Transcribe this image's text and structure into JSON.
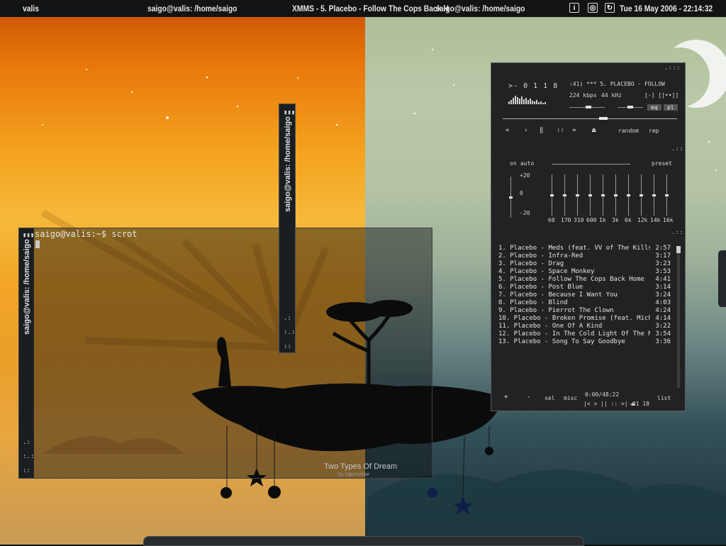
{
  "topbar": {
    "menu_label": "valis",
    "window_title_1": "saigo@valis: /home/saigo",
    "window_title_2": "XMMS - 5. Placebo - Follow The Cops Back H",
    "window_title_3": "saigo@valis: /home/saigo",
    "datetime": "Tue 16 May 2006 - 22:14:32",
    "tray_icons": [
      "info-icon",
      "camera-icon",
      "refresh-icon"
    ]
  },
  "wallpaper": {
    "caption": "Two Types Of Dream",
    "credit": "by UgurValdar"
  },
  "terminal": {
    "side_title": "saigo@valis: /home/saigo",
    "prompt_line": "saigo@valis:~$ scrot"
  },
  "small_window": {
    "side_title": "saigo@valis: /home/saigo"
  },
  "xmms": {
    "time": "- 0 1 1 8",
    "ticker": ":41)  ***  5. PLACEBO - FOLLOW",
    "kbps": "224",
    "kbps_unit": "kbps",
    "khz": "44",
    "khz_unit": "kHz",
    "mono_stereo": "[-]  [[••]]",
    "eq_button": "eq",
    "pl_button": "pl",
    "random_label": "random",
    "repeat_label": "rep",
    "transport": [
      "prev-icon",
      "play-icon",
      "pause-icon",
      "stop-icon",
      "next-icon",
      "eject-icon"
    ],
    "seek_position": 0.58,
    "volume_level": 0.55,
    "balance_level": 0.5,
    "equalizer": {
      "on_label": "on",
      "auto_label": "auto",
      "preset_label": "preset",
      "scale_top": "+20",
      "scale_mid": "0",
      "scale_bottom": "-20",
      "preamp": 0.5,
      "bands": [
        {
          "label": "60",
          "level": 0.5
        },
        {
          "label": "170",
          "level": 0.5
        },
        {
          "label": "310",
          "level": 0.5
        },
        {
          "label": "600",
          "level": 0.5
        },
        {
          "label": "1k",
          "level": 0.5
        },
        {
          "label": "3k",
          "level": 0.5
        },
        {
          "label": "6k",
          "level": 0.5
        },
        {
          "label": "12k",
          "level": 0.5
        },
        {
          "label": "14k",
          "level": 0.5
        },
        {
          "label": "16k",
          "level": 0.5
        }
      ]
    },
    "playlist": [
      {
        "title": "1. Placebo - Meds (feat. VV of The Kills)",
        "duration": "2:57"
      },
      {
        "title": "2. Placebo - Infra-Red",
        "duration": "3:17"
      },
      {
        "title": "3. Placebo - Drag",
        "duration": "3:23"
      },
      {
        "title": "4. Placebo - Space Monkey",
        "duration": "3:53"
      },
      {
        "title": "5. Placebo - Follow The Cops Back Home",
        "duration": "4:41"
      },
      {
        "title": "6. Placebo - Post Blue",
        "duration": "3:14"
      },
      {
        "title": "7. Placebo - Because I Want You",
        "duration": "3:24"
      },
      {
        "title": "8. Placebo - Blind",
        "duration": "4:03"
      },
      {
        "title": "9. Placebo - Pierrot The Clown",
        "duration": "4:24"
      },
      {
        "title": "10. Placebo - Broken Promise (feat. Mich...",
        "duration": "4:14"
      },
      {
        "title": "11. Placebo - One Of A Kind",
        "duration": "3:22"
      },
      {
        "title": "12. Placebo - In The Cold Light Of The M...",
        "duration": "3:54"
      },
      {
        "title": "13. Placebo - Song To Say Goodbye",
        "duration": "3:36"
      }
    ],
    "pl_add": "+",
    "pl_remove": "-",
    "pl_sel": "sel",
    "pl_misc": "misc",
    "pl_total": "0:00/48:22",
    "pl_time": "-01 18",
    "pl_list": "list"
  }
}
